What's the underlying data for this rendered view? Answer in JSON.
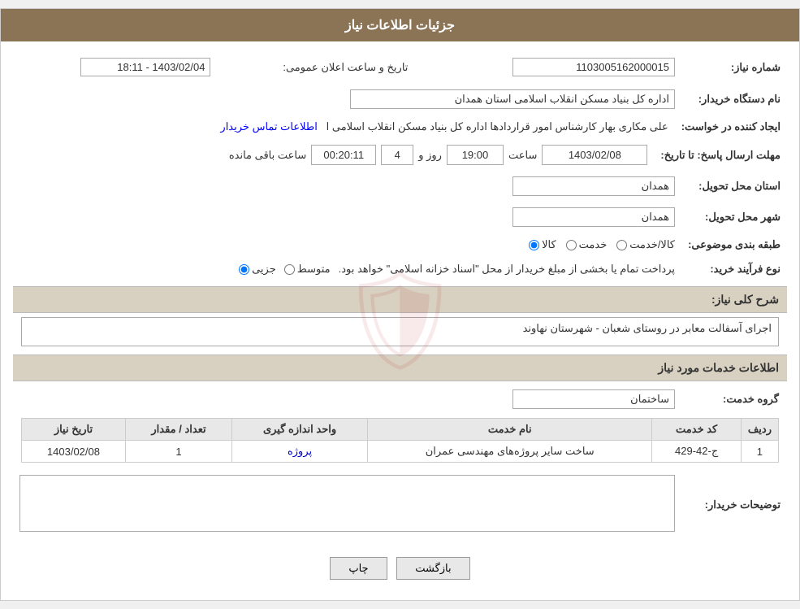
{
  "header": {
    "title": "جزئیات اطلاعات نیاز"
  },
  "fields": {
    "shomara_niaz_label": "شماره نیاز:",
    "shomara_niaz_value": "1103005162000015",
    "nam_dastgah_label": "نام دستگاه خریدار:",
    "nam_dastgah_value": "اداره کل بنیاد مسکن انقلاب اسلامی استان همدان",
    "ijad_label": "ایجاد کننده در خواست:",
    "ijad_contact_text": "اطلاعات تماس خریدار",
    "ijad_value": "علی مکاری بهار کارشناس امور قراردادها اداره کل بنیاد مسکن انقلاب اسلامی ا",
    "mohlat_label": "مهلت ارسال پاسخ: تا تاریخ:",
    "date_value": "1403/02/08",
    "time_label": "ساعت",
    "time_value": "19:00",
    "roz_label": "روز و",
    "roz_value": "4",
    "remaining_label": "ساعت باقی مانده",
    "remaining_value": "00:20:11",
    "ostan_label": "استان محل تحویل:",
    "ostan_value": "همدان",
    "shahr_label": "شهر محل تحویل:",
    "shahr_value": "همدان",
    "tabaqe_label": "طبقه بندی موضوعی:",
    "tabaqe_kala": "کالا",
    "tabaqe_khadamat": "خدمت",
    "tabaqe_kala_khadamat": "کالا/خدمت",
    "nooe_label": "نوع فرآیند خرید:",
    "nooe_jozii": "جزیی",
    "nooe_motevaset": "متوسط",
    "nooe_detail": "پرداخت تمام یا بخشی از مبلغ خریدار از محل \"اسناد خزانه اسلامی\" خواهد بود.",
    "tarikh_aalan_label": "تاریخ و ساعت اعلان عمومی:",
    "tarikh_aalan_value": "1403/02/04 - 18:11",
    "sharh_label": "شرح کلی نیاز:",
    "sharh_value": "اجرای آسفالت معابر در روستای شعبان - شهرستان نهاوند",
    "info_services_header": "اطلاعات خدمات مورد نیاز",
    "group_label": "گروه خدمت:",
    "group_value": "ساختمان",
    "table_headers": {
      "radif": "ردیف",
      "code": "کد خدمت",
      "name": "نام خدمت",
      "unit": "واحد اندازه گیری",
      "count": "تعداد / مقدار",
      "date": "تاریخ نیاز"
    },
    "table_rows": [
      {
        "radif": "1",
        "code": "ج-42-429",
        "name": "ساخت سایر پروژه‌های مهندسی عمران",
        "unit": "پروژه",
        "count": "1",
        "date": "1403/02/08"
      }
    ],
    "tozihat_label": "توضیحات خریدار:",
    "tozihat_value": "",
    "btn_chap": "چاپ",
    "btn_bazgasht": "بازگشت"
  }
}
